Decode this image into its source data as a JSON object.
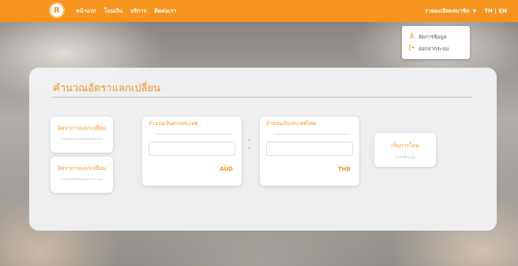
{
  "brand": {
    "logo_letter": "R"
  },
  "nav": {
    "links": [
      "หน้าแรก",
      "โอนเงิน",
      "บริการ",
      "ติดต่อเรา"
    ],
    "user_menu": "รายละเอียดสมาชิก",
    "lang": "TH | EN"
  },
  "dropdown": {
    "items": [
      {
        "label": "จัดการข้อมูล",
        "icon": "user-icon"
      },
      {
        "label": "ออกจากระบบ",
        "icon": "logout-icon"
      }
    ]
  },
  "main": {
    "title": "คำนวณอัตราแลกเปลี่ยน",
    "options": [
      {
        "title": "อัตราการแลกเปลี่ยน",
        "subtitle": "แลกเงินต่างประเทศเป็นเงินไทย"
      },
      {
        "title": "อัตราการแลกเปลี่ยน",
        "subtitle": "แลกเงินไทยเป็นเงินต่างประเทศ"
      }
    ],
    "foreign": {
      "label": "จำนวนเงินต่างประเทศ",
      "value": "",
      "currency": "AUD"
    },
    "thai": {
      "label": "จำนวนเงินประเทศไทย",
      "value": "",
      "currency": "THB"
    },
    "swap_icon": "swap-arrows-icon",
    "swap_top": "»",
    "swap_bottom": "»",
    "start": {
      "title": "เริ่มการโอน",
      "subtitle": "แลกเปลี่ยนเงิน"
    }
  },
  "colors": {
    "accent": "#f7941d",
    "panel": "#f3f4f6"
  }
}
